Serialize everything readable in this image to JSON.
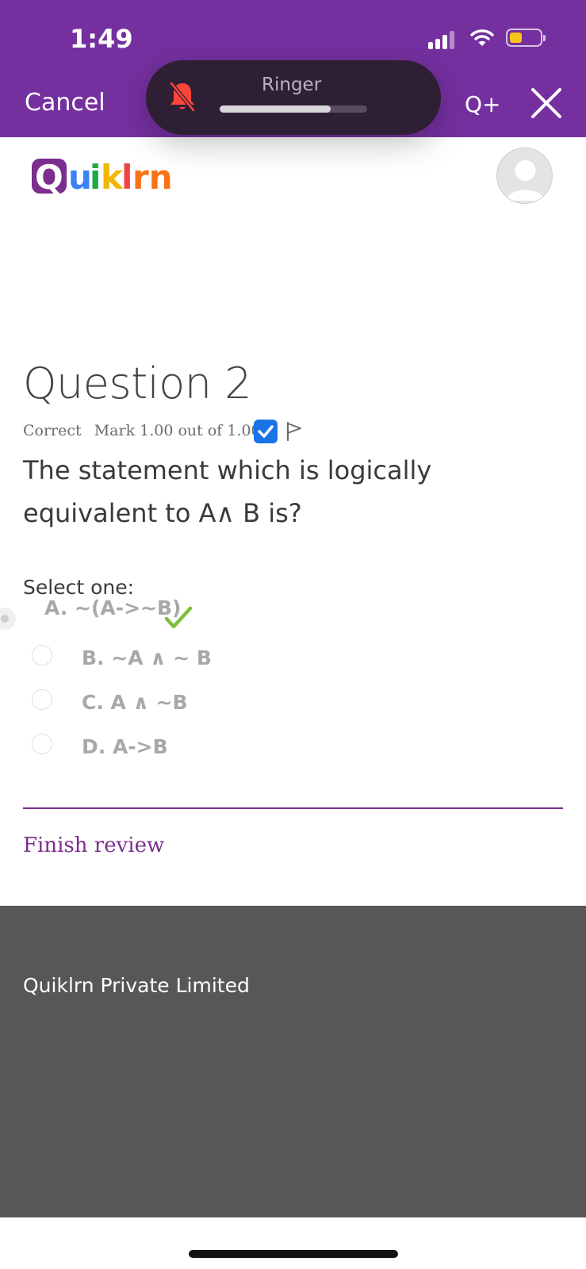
{
  "status_bar": {
    "time": "1:49",
    "battery_level": 0.4
  },
  "nav": {
    "cancel_label": "Cancel",
    "q_plus_label": "Q+"
  },
  "ringer": {
    "label": "Ringer",
    "volume": 0.75
  },
  "brand": {
    "logo_text": "Quiklrn"
  },
  "question": {
    "title": "Question 2",
    "state": "Correct",
    "mark": "Mark 1.00 out of 1.00",
    "text": "The statement which is logically equivalent to A∧ B is?",
    "prompt": "Select one:"
  },
  "options": [
    {
      "label": "A. ~(A->~B)",
      "selected": true,
      "correct": true
    },
    {
      "label": "B. ~A ∧ ~ B",
      "selected": false
    },
    {
      "label": "C. A ∧ ~B",
      "selected": false
    },
    {
      "label": "D. A->B",
      "selected": false
    }
  ],
  "actions": {
    "finish_label": "Finish review"
  },
  "footer": {
    "company": "Quiklrn Private Limited"
  },
  "colors": {
    "header": "#7530a0",
    "accent": "#7b2e8e",
    "footer": "#575757",
    "checkbox": "#1a73e8",
    "tick": "#7dc03a"
  },
  "icons": [
    "signal-icon",
    "wifi-icon",
    "battery-icon",
    "bell-muted-icon",
    "close-icon",
    "avatar-icon",
    "checkbox-icon",
    "flag-icon",
    "tick-icon"
  ]
}
